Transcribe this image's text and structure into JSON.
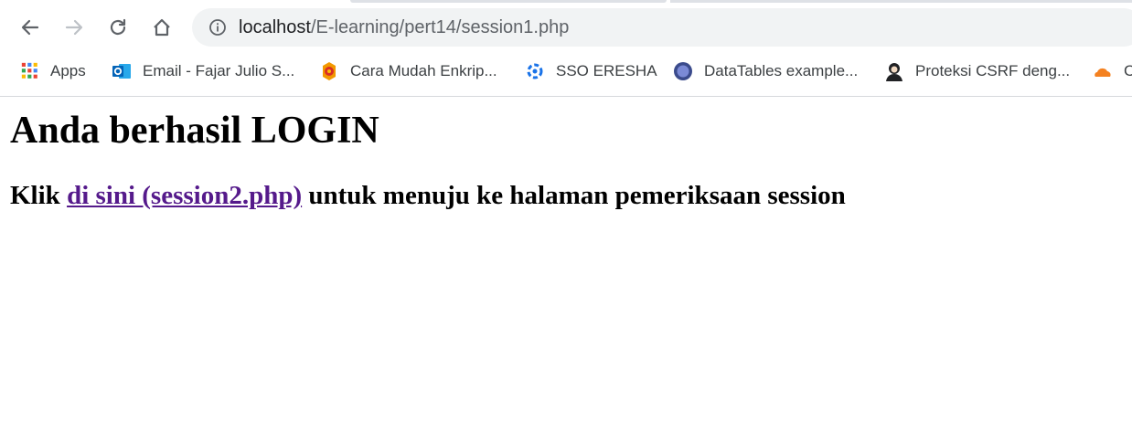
{
  "browser": {
    "url_host": "localhost",
    "url_path": "/E-learning/pert14/session1.php",
    "bookmarks": [
      {
        "label": "Apps",
        "icon": "apps-grid-icon"
      },
      {
        "label": "Email - Fajar Julio S...",
        "icon": "outlook-icon"
      },
      {
        "label": "Cara Mudah Enkrip...",
        "icon": "site-favicon"
      },
      {
        "label": "SSO ERESHA",
        "icon": "sso-favicon"
      },
      {
        "label": "DataTables example...",
        "icon": "datatables-favicon"
      },
      {
        "label": "Proteksi CSRF deng...",
        "icon": "avatar-favicon"
      },
      {
        "label": "C",
        "icon": "cloudflare-icon"
      }
    ]
  },
  "page": {
    "heading": "Anda berhasil LOGIN",
    "prefix": "Klik ",
    "link_text": "di sini (session2.php)",
    "suffix": " untuk menuju ke halaman pemeriksaan session"
  },
  "colors": {
    "link_visited": "#551a8b",
    "omnibox_bg": "#f1f3f4"
  }
}
